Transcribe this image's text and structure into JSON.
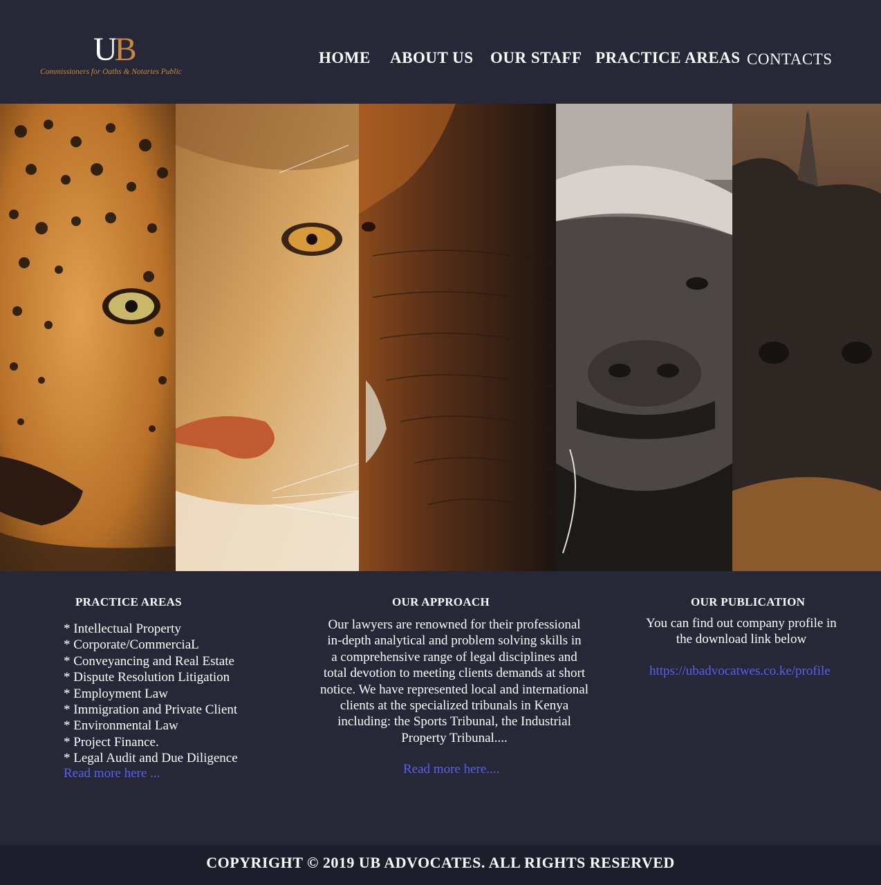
{
  "brand": {
    "logo_u": "U",
    "logo_b": "B",
    "tagline": "Commissioners for Oaths & Notaries Public"
  },
  "nav": {
    "home": "HOME",
    "about": "ABOUT US",
    "staff": "OUR STAFF",
    "practice": "PRACTICE AREAS",
    "contacts": "CONTACTS"
  },
  "hero": {
    "panels": [
      "leopard",
      "lion",
      "elephant",
      "buffalo",
      "rhino"
    ]
  },
  "practice": {
    "title": "PRACTICE AREAS",
    "items": [
      "* Intellectual Property",
      "* Corporate/CommerciaL",
      "* Conveyancing and Real Estate",
      "* Dispute Resolution Litigation",
      "* Employment Law",
      "* Immigration and Private Client",
      "* Environmental Law",
      "* Project Finance.",
      "* Legal Audit and Due Diligence"
    ],
    "read_more": "Read more here ..."
  },
  "approach": {
    "title": "OUR APPROACH",
    "lines": [
      "Our lawyers are renowned for their professional",
      "in-depth analytical and problem solving skills in",
      "a comprehensive range of legal disciplines and",
      "total devotion to meeting clients demands at short",
      "notice. We have represented local and international",
      "clients at the specialized tribunals in Kenya",
      "including: the Sports Tribunal, the Industrial",
      "Property Tribunal...."
    ],
    "read_more": "Read more here...."
  },
  "publication": {
    "title": "OUR PUBLICATION",
    "line1": "You can find out company profile in",
    "line2": "the download link below",
    "link": "https://ubadvocatwes.co.ke/profile"
  },
  "footer": {
    "copyright": "COPYRIGHT © 2019 UB ADVOCATES. ALL RIGHTS RESERVED"
  },
  "colors": {
    "background": "#262837",
    "footer": "#1d1e2b",
    "accent_gold": "#c9873f",
    "link_blue": "#5a5ff0"
  }
}
